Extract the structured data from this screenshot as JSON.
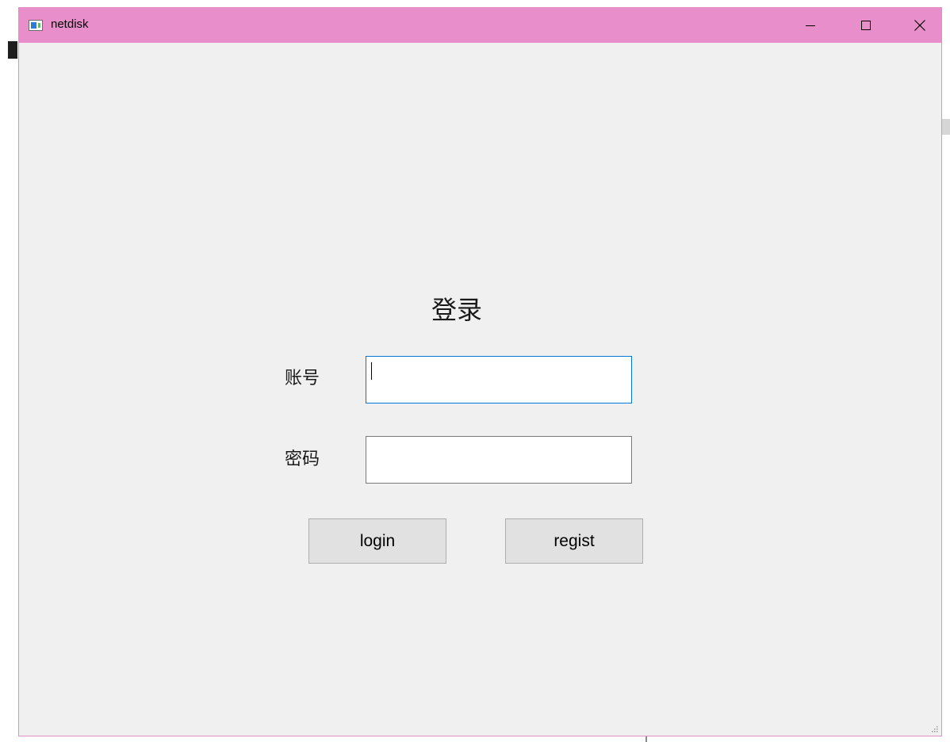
{
  "window": {
    "title": "netdisk",
    "accent_color": "#e88fcb"
  },
  "titlebar_controls": {
    "minimize_icon": "minimize-icon",
    "maximize_icon": "maximize-icon",
    "close_icon": "close-icon"
  },
  "login_form": {
    "heading": "登录",
    "account_label": "账号",
    "account_value": "",
    "password_label": "密码",
    "password_value": "",
    "login_button": "login",
    "regist_button": "regist",
    "focus_color": "#0078d7"
  }
}
